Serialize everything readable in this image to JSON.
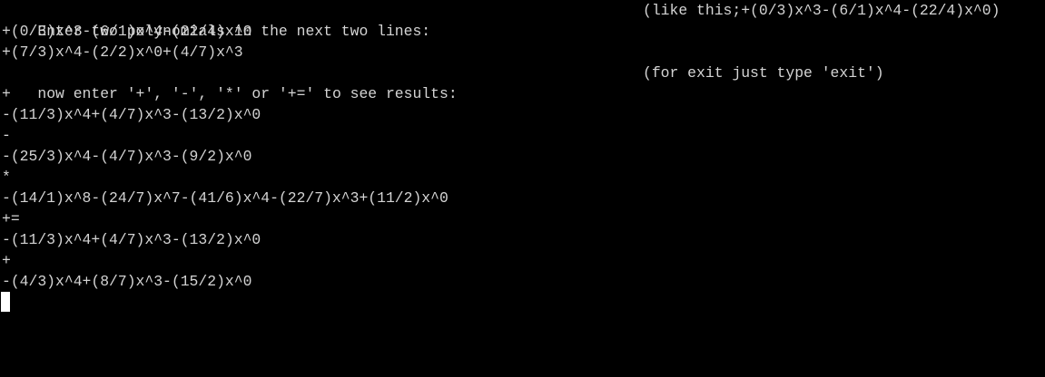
{
  "terminal": {
    "lines": [
      "Enter two polynomials in the next two lines:",
      "+(0/3)x^3-(6/1)x^4-(22/4)x^0",
      "+(7/3)x^4-(2/2)x^0+(4/7)x^3",
      "now enter '+', '-', '*' or '+=' to see results:",
      "+",
      "-(11/3)x^4+(4/7)x^3-(13/2)x^0",
      "-",
      "-(25/3)x^4-(4/7)x^3-(9/2)x^0",
      "*",
      "-(14/1)x^8-(24/7)x^7-(41/6)x^4-(22/7)x^3+(11/2)x^0",
      "+=",
      "-(11/3)x^4+(4/7)x^3-(13/2)x^0",
      "+",
      "-(4/3)x^4+(8/7)x^3-(15/2)x^0"
    ],
    "hint_example": "(like this;+(0/3)x^3-(6/1)x^4-(22/4)x^0)",
    "hint_exit": "(for exit just type 'exit')"
  },
  "colors": {
    "background": "#000000",
    "text": "#d4d4d4",
    "cursor": "#ffffff"
  }
}
